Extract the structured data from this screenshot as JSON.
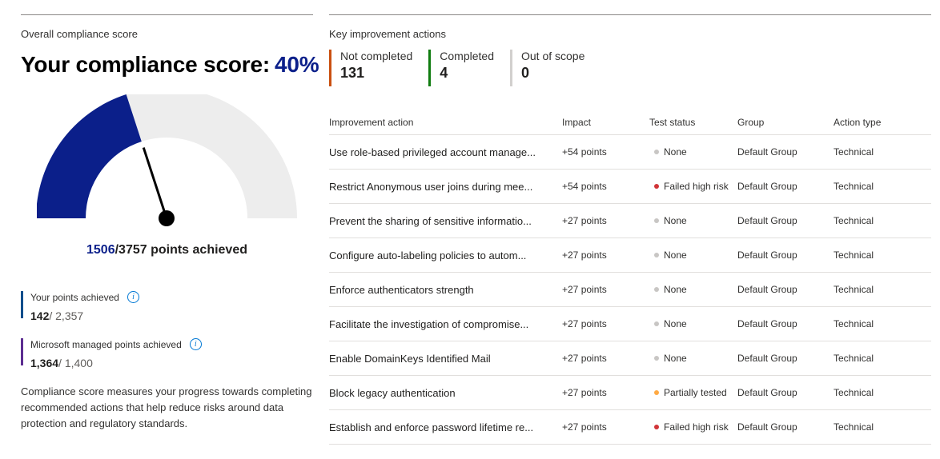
{
  "left": {
    "section_title": "Overall compliance score",
    "score_label": "Your compliance score:",
    "score_percent": "40%",
    "score_value": 0.4,
    "points_achieved": "1506",
    "points_total_text": "/3757 points achieved",
    "your_points": {
      "label": "Your points achieved",
      "value": "142",
      "total": "/ 2,357",
      "color": "#004e8c"
    },
    "ms_points": {
      "label": "Microsoft managed points achieved",
      "value": "1,364",
      "total": "/ 1,400",
      "color": "#5c2d91"
    },
    "description": "Compliance score measures your progress towards completing recommended actions that help reduce risks around data protection and regulatory standards."
  },
  "right": {
    "section_title": "Key improvement actions",
    "tiles": [
      {
        "label": "Not completed",
        "value": "131",
        "color": "#ca5010"
      },
      {
        "label": "Completed",
        "value": "4",
        "color": "#107c10"
      },
      {
        "label": "Out of scope",
        "value": "0",
        "color": "#d2d0ce"
      }
    ],
    "columns": [
      "Improvement action",
      "Impact",
      "Test status",
      "Group",
      "Action type"
    ],
    "rows": [
      {
        "action": "Use role-based privileged account manage...",
        "impact": "+54 points",
        "status": "None",
        "status_color": "#c8c6c4",
        "group": "Default Group",
        "type": "Technical"
      },
      {
        "action": "Restrict Anonymous user joins during mee...",
        "impact": "+54 points",
        "status": "Failed high risk",
        "status_color": "#d13438",
        "group": "Default Group",
        "type": "Technical"
      },
      {
        "action": "Prevent the sharing of sensitive informatio...",
        "impact": "+27 points",
        "status": "None",
        "status_color": "#c8c6c4",
        "group": "Default Group",
        "type": "Technical"
      },
      {
        "action": "Configure auto-labeling policies to autom...",
        "impact": "+27 points",
        "status": "None",
        "status_color": "#c8c6c4",
        "group": "Default Group",
        "type": "Technical"
      },
      {
        "action": "Enforce authenticators strength",
        "impact": "+27 points",
        "status": "None",
        "status_color": "#c8c6c4",
        "group": "Default Group",
        "type": "Technical"
      },
      {
        "action": "Facilitate the investigation of compromise...",
        "impact": "+27 points",
        "status": "None",
        "status_color": "#c8c6c4",
        "group": "Default Group",
        "type": "Technical"
      },
      {
        "action": "Enable DomainKeys Identified Mail",
        "impact": "+27 points",
        "status": "None",
        "status_color": "#c8c6c4",
        "group": "Default Group",
        "type": "Technical"
      },
      {
        "action": "Block legacy authentication",
        "impact": "+27 points",
        "status": "Partially tested",
        "status_color": "#ffaa44",
        "group": "Default Group",
        "type": "Technical"
      },
      {
        "action": "Establish and enforce password lifetime re...",
        "impact": "+27 points",
        "status": "Failed high risk",
        "status_color": "#d13438",
        "group": "Default Group",
        "type": "Technical"
      }
    ]
  },
  "colors": {
    "accent": "#0b1f8a",
    "gauge_track": "#ededed",
    "needle": "#000000"
  }
}
